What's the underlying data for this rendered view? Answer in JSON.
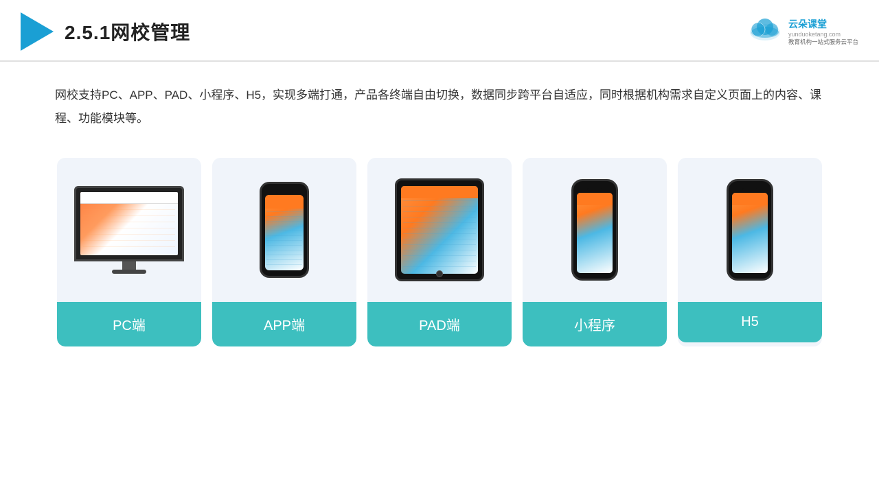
{
  "header": {
    "title": "2.5.1网校管理",
    "brand": {
      "name": "云朵课堂",
      "url": "yunduoketang.com",
      "tagline": "教育机构一站\n式服务云平台"
    }
  },
  "description": {
    "text": "网校支持PC、APP、PAD、小程序、H5，实现多端打通，产品各终端自由切换，数据同步跨平台自适应，同时根据机构需求自定义页面上的内容、课程、功能模块等。"
  },
  "cards": [
    {
      "label": "PC端",
      "type": "monitor"
    },
    {
      "label": "APP端",
      "type": "phone"
    },
    {
      "label": "PAD端",
      "type": "tablet"
    },
    {
      "label": "小程序",
      "type": "phone2"
    },
    {
      "label": "H5",
      "type": "phone3"
    }
  ]
}
